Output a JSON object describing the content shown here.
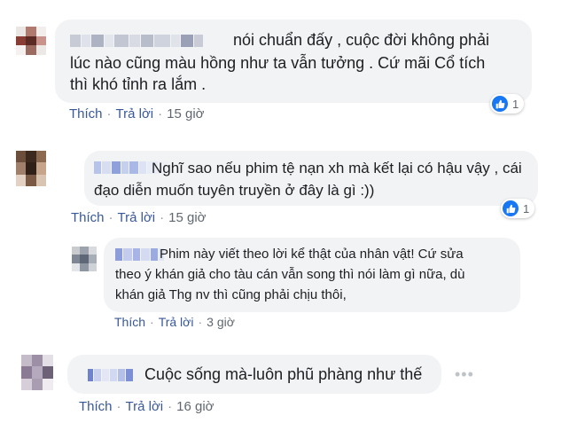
{
  "comments": [
    {
      "lines": [
        "nói chuẩn đấy , cuộc đời không phải",
        "lúc nào cũng màu hồng như ta vẫn tưởng . Cứ mãi Cổ tích",
        "thì khó tỉnh ra lắm ."
      ],
      "actions": {
        "like": "Thích",
        "reply": "Trả lời",
        "time": "15 giờ"
      },
      "reaction_count": "1"
    },
    {
      "lines": [
        "Nghĩ sao nếu phim tệ nạn xh mà kết lại có hậu vậy , cái",
        "đạo diễn muốn tuyên truyền ở đây là gì :))"
      ],
      "actions": {
        "like": "Thích",
        "reply": "Trả lời",
        "time": "15 giờ"
      },
      "reaction_count": "1"
    },
    {
      "lines": [
        "Phim này viết theo lời kể thật của nhân vật! Cứ sửa",
        "theo ý khán giả cho tàu cán vẫn song thì nói làm gì nữa, dù",
        "khán giả Thg nv thì cũng phải chịu thôi,"
      ],
      "actions": {
        "like": "Thích",
        "reply": "Trả lời",
        "time": "3 giờ"
      }
    },
    {
      "lines": [
        "Cuộc sống mà-luôn phũ phàng như thế"
      ],
      "actions": {
        "like": "Thích",
        "reply": "Trả lời",
        "time": "16 giờ"
      },
      "more": "•••"
    }
  ],
  "colors": {
    "link": "#385898",
    "bubble": "#f2f3f5",
    "like_badge": "#1877f2"
  }
}
